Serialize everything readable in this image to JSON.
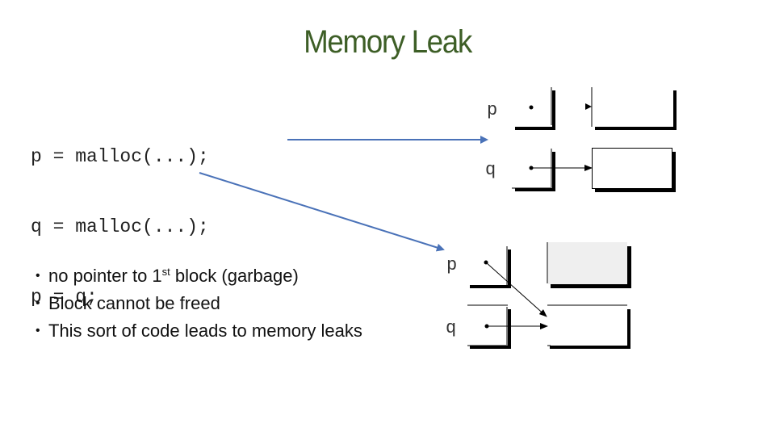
{
  "slide": {
    "title": "Memory Leak",
    "code_lines": [
      "p = malloc(...);",
      "q = malloc(...);",
      "p = q;"
    ],
    "bullets": [
      {
        "before": "no pointer to 1",
        "sup": "st",
        "after": " block (garbage)"
      },
      {
        "before": "Block cannot be freed",
        "sup": "",
        "after": ""
      },
      {
        "before": "This sort of code leads to memory leaks",
        "sup": "",
        "after": ""
      }
    ],
    "diagram_before": {
      "labels": {
        "p": "p",
        "q": "q"
      }
    },
    "diagram_after": {
      "labels": {
        "p": "p",
        "q": "q"
      },
      "leaked_block_color": "#efefef"
    },
    "colors": {
      "title": "#3d5e26",
      "annotation_arrow": "#4a72b8"
    }
  }
}
